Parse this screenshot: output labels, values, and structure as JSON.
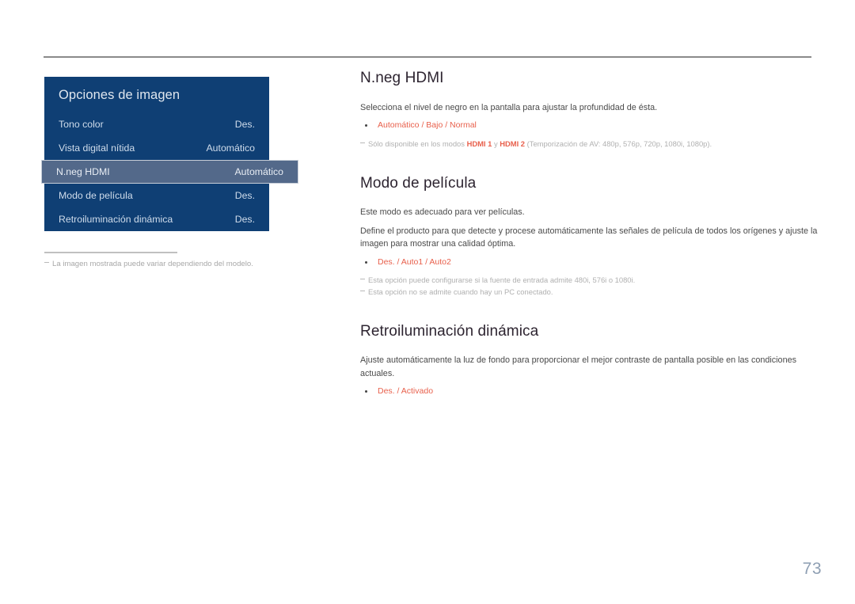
{
  "document": {
    "page_number": "73"
  },
  "osd_menu": {
    "title": "Opciones de imagen",
    "rows": [
      {
        "label": "Tono color",
        "value": "Des.",
        "selected": false
      },
      {
        "label": "Vista digital nítida",
        "value": "Automático",
        "selected": false
      },
      {
        "label": "N.neg HDMI",
        "value": "Automático",
        "selected": true
      },
      {
        "label": "Modo de película",
        "value": "Des.",
        "selected": false
      },
      {
        "label": "Retroiluminación dinámica",
        "value": "Des.",
        "selected": false
      }
    ],
    "caption": "La imagen mostrada puede variar dependiendo del modelo."
  },
  "sections": [
    {
      "title": "N.neg HDMI",
      "body": [
        "Selecciona el nivel de negro en la pantalla para ajustar la profundidad de ésta."
      ],
      "options": [
        {
          "first": "Automático",
          "rest": " / Bajo / Normal"
        }
      ],
      "footnotes": [
        {
          "parts": [
            {
              "text": "Sólo disponible en los modos ",
              "highlight": false
            },
            {
              "text": "HDMI 1",
              "highlight": true
            },
            {
              "text": " y ",
              "highlight": false
            },
            {
              "text": "HDMI 2",
              "highlight": true
            },
            {
              "text": " (Temporización de AV: 480p, 576p, 720p, 1080i, 1080p).",
              "highlight": false
            }
          ]
        }
      ]
    },
    {
      "title": "Modo de película",
      "body": [
        "Este modo es adecuado para ver películas.",
        "Define el producto para que detecte y procese automáticamente las señales de película de todos los orígenes y ajuste la imagen para mostrar una calidad óptima."
      ],
      "options": [
        {
          "first": "Des.",
          "rest": " / Auto1 / Auto2"
        }
      ],
      "footnotes": [
        {
          "parts": [
            {
              "text": "Esta opción puede configurarse si la fuente de entrada admite 480i, 576i o 1080i.",
              "highlight": false
            }
          ]
        },
        {
          "parts": [
            {
              "text": "Esta opción no se admite cuando hay un PC conectado.",
              "highlight": false
            }
          ]
        }
      ]
    },
    {
      "title": "Retroiluminación dinámica",
      "body": [
        "Ajuste automáticamente la luz de fondo para proporcionar el mejor contraste de pantalla posible en las condiciones actuales."
      ],
      "options": [
        {
          "first": "Des.",
          "rest": " / Activado"
        }
      ],
      "footnotes": []
    }
  ],
  "colors": {
    "panel_bg": "#0f3f74",
    "panel_highlight": "#53698a",
    "accent": "#e8604c",
    "heading": "#2d2430",
    "page_number": "#8e9fb3"
  }
}
